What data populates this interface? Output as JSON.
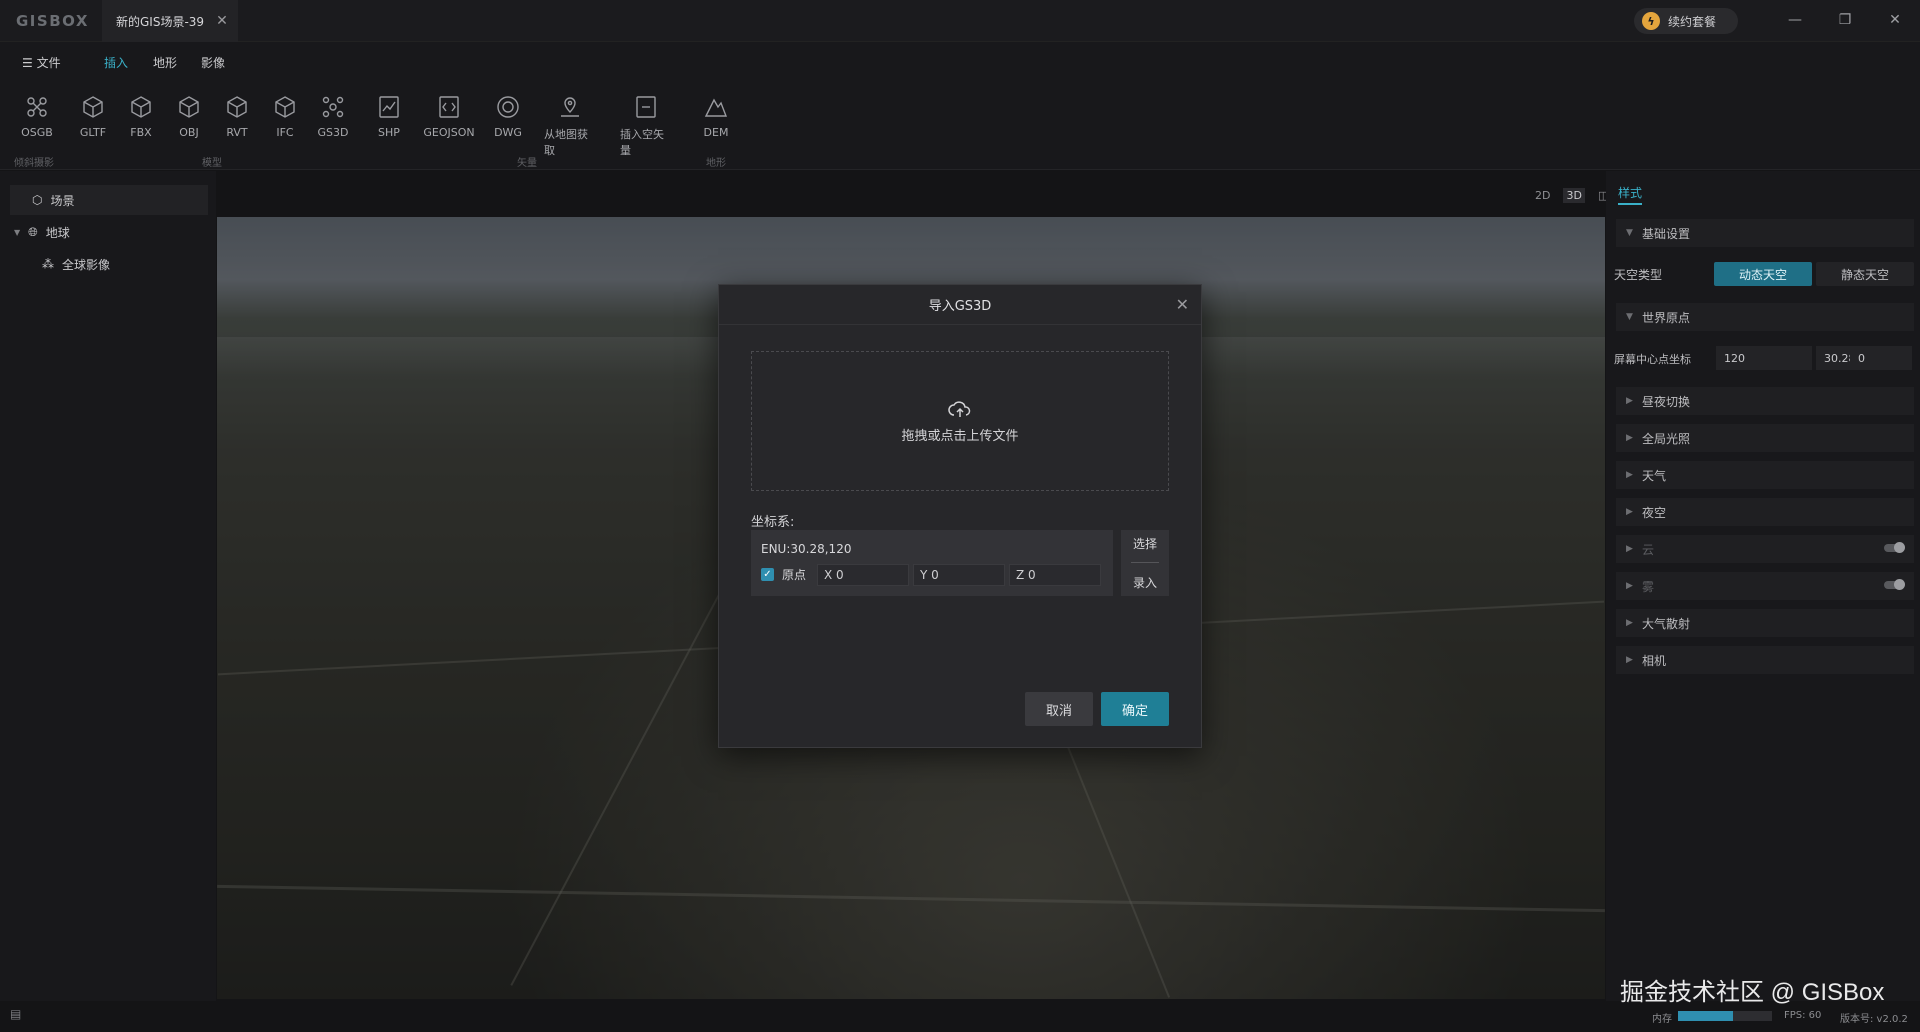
{
  "app": {
    "logo": "GISBOX",
    "doc_tab": "新的GIS场景-39",
    "renew_label": "续约套餐"
  },
  "menu": {
    "file": "文件",
    "items": [
      "插入",
      "地形",
      "影像"
    ],
    "active": "插入"
  },
  "ribbon": {
    "tools": [
      {
        "label": "OSGB",
        "icon": "osgb-icon"
      },
      {
        "label": "GLTF",
        "icon": "cube-icon"
      },
      {
        "label": "FBX",
        "icon": "cube-icon"
      },
      {
        "label": "OBJ",
        "icon": "cube-icon"
      },
      {
        "label": "RVT",
        "icon": "cube-icon"
      },
      {
        "label": "IFC",
        "icon": "cube-icon"
      },
      {
        "label": "GS3D",
        "icon": "gs3d-icon"
      },
      {
        "label": "SHP",
        "icon": "shp-icon"
      },
      {
        "label": "GEOJSON",
        "icon": "geojson-icon"
      },
      {
        "label": "DWG",
        "icon": "dwg-icon"
      },
      {
        "label": "从地图获取",
        "icon": "map-pick-icon"
      },
      {
        "label": "插入空矢量",
        "icon": "empty-vector-icon"
      },
      {
        "label": "DEM",
        "icon": "dem-icon"
      }
    ],
    "groups": [
      "倾斜摄影",
      "模型",
      "矢量",
      "地形"
    ]
  },
  "tree": {
    "scene": "场景",
    "earth": "地球",
    "global_imagery": "全球影像"
  },
  "view_modes": [
    "2D",
    "3D",
    "◫"
  ],
  "right_panel": {
    "tab": "样式",
    "basic_settings": "基础设置",
    "sky_type_label": "天空类型",
    "sky_dynamic": "动态天空",
    "sky_static": "静态天空",
    "world_origin": "世界原点",
    "screen_center_label": "屏幕中心点坐标",
    "screen_center": [
      "120",
      "30.28",
      "0"
    ],
    "sections": [
      "昼夜切换",
      "全局光照",
      "天气",
      "夜空",
      "云",
      "雾",
      "大气散射",
      "相机"
    ],
    "toggle_sections": [
      "云",
      "雾"
    ]
  },
  "modal": {
    "title": "导入GS3D",
    "upload_text": "拖拽或点击上传文件",
    "crs_label": "坐标系:",
    "crs_value": "ENU:30.28,120",
    "origin_label": "原点",
    "x_value": "X 0",
    "y_value": "Y 0",
    "z_value": "Z 0",
    "select_label": "选择",
    "enter_label": "录入",
    "cancel_label": "取消",
    "ok_label": "确定"
  },
  "status": {
    "watermark": "掘金技术社区 @ GISBox",
    "memory_label": "内存",
    "memory_fraction": 0.58,
    "fps": "FPS: 60",
    "version": "版本号: v2.0.2"
  },
  "colors": {
    "accent": "#3ab0c8",
    "primary_button": "#1f7f96",
    "panel_bg": "#18181b",
    "modal_bg": "#27272a"
  }
}
